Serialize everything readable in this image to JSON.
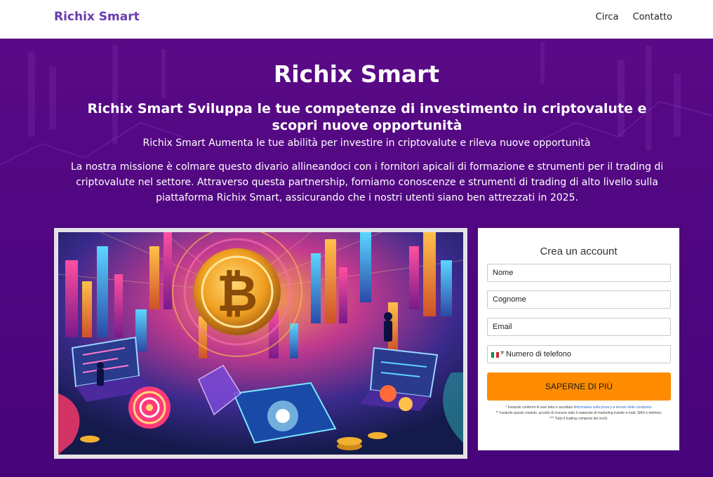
{
  "navbar": {
    "brand": "Richix Smart",
    "links": [
      "Circa",
      "Contatto"
    ]
  },
  "hero": {
    "title": "Richix Smart",
    "subtitle": "Richix Smart Sviluppa le tue competenze di investimento in criptovalute e scopri nuove opportunità",
    "tagline": "Richix Smart Aumenta le tue abilità per investire in criptovalute e rileva nuove opportunità",
    "mission": "La nostra missione è colmare questo divario allineandoci con i fornitori apicali di formazione e strumenti per il trading di criptovalute nel settore. Attraverso questa partnership, forniamo conoscenze e strumenti di trading di alto livello sulla piattaforma Richix Smart, assicurando che i nostri utenti siano ben attrezzati in 2025."
  },
  "form": {
    "title": "Crea un account",
    "first_name_placeholder": "Nome",
    "last_name_placeholder": "Cognome",
    "email_placeholder": "Email",
    "phone_placeholder": "Numero di telefono",
    "submit_label": "SAPERNE DI PIÙ",
    "disclaimer": {
      "line1_prefix": "* Inviando confermi di aver letto e accettato l",
      "privacy_link": "informativa sulla privacy",
      "and": " e ",
      "terms_link": "termini delle condizioni",
      "line1_suffix": ".",
      "line2": "** Inviando questo modulo, accetto di ricevere tutto il materiale di marketing tramite e-mail, SMS e telefono.",
      "line3": "*** Tutto il trading comporta dei rischi."
    }
  },
  "colors": {
    "brand": "#6a3bb0",
    "hero_bg": "#4e0680",
    "cta": "#ff8c00"
  },
  "icons": {
    "flag": "italy-flag-icon",
    "hero_image": "crypto-bitcoin-illustration"
  }
}
